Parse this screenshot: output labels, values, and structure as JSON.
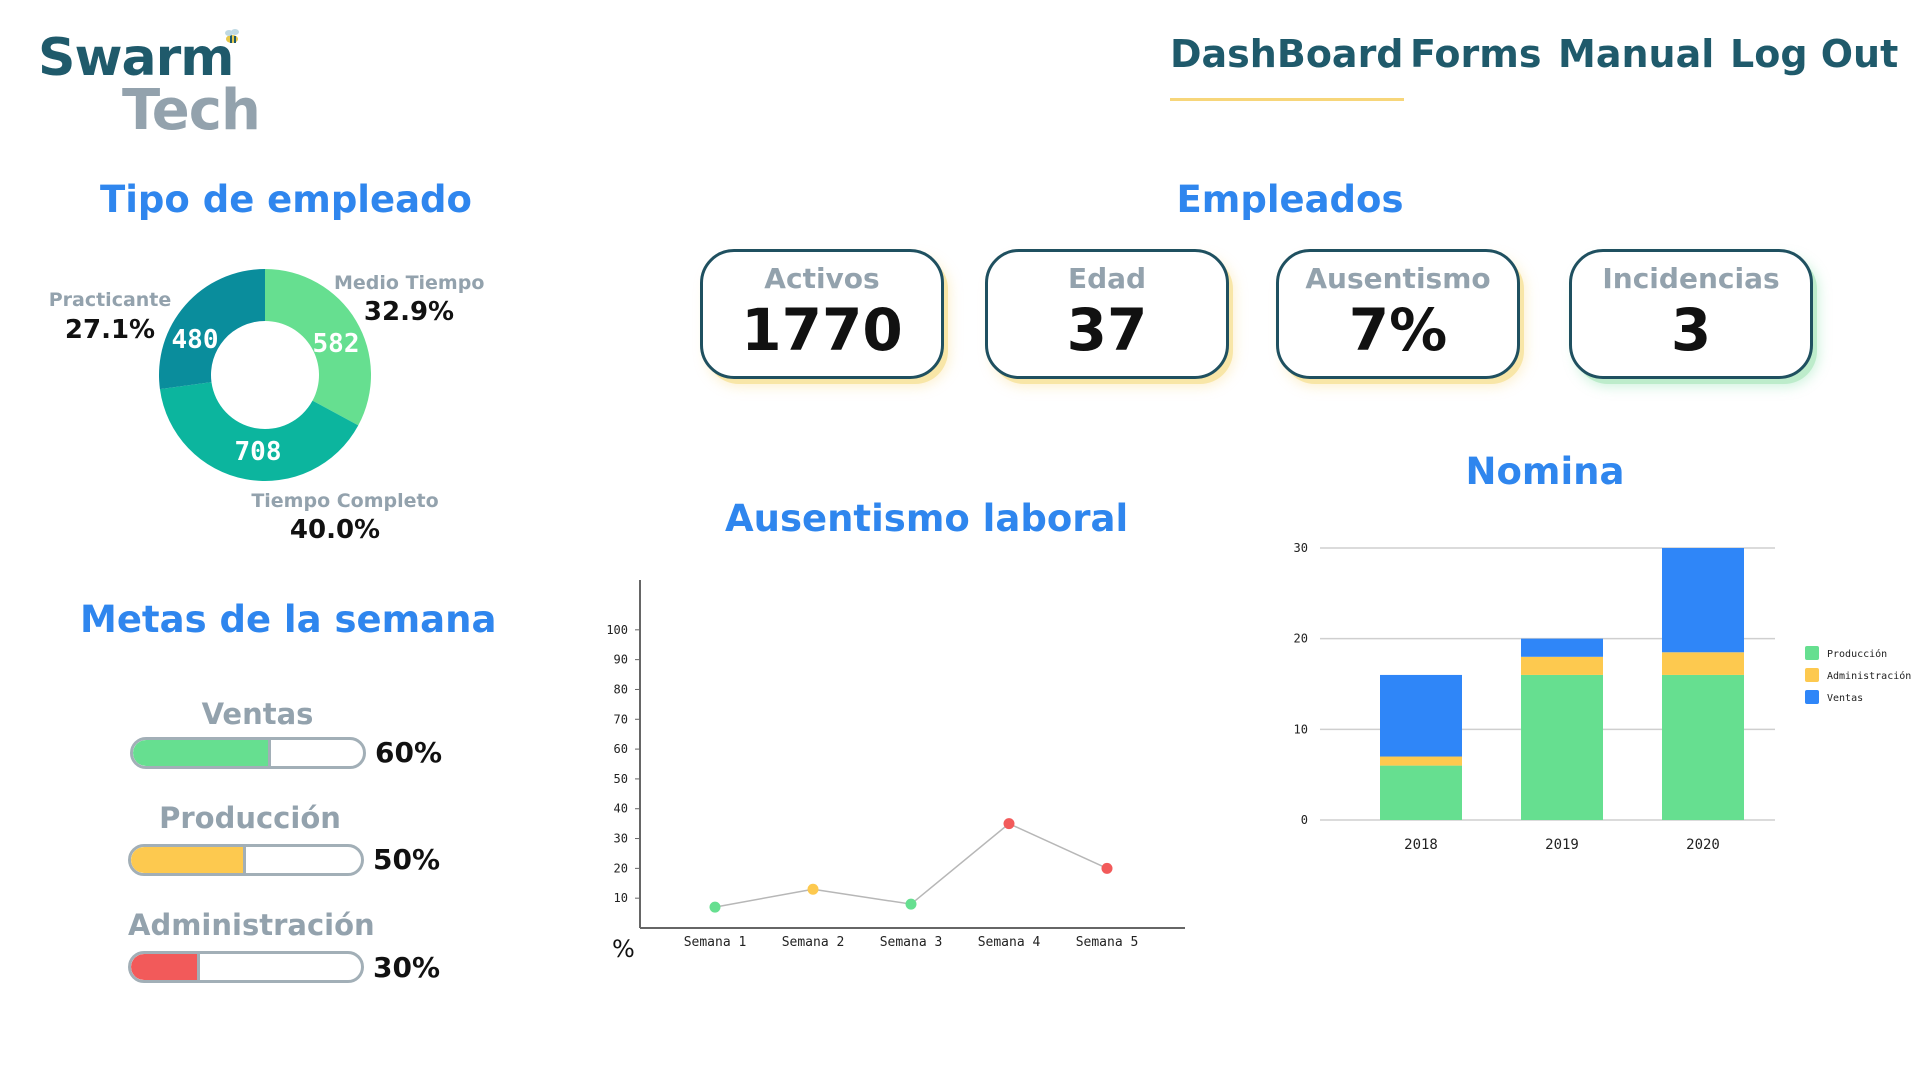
{
  "logo": {
    "line1": "Swarm",
    "line2": "Tech"
  },
  "nav": [
    {
      "label": "DashBoard",
      "active": true
    },
    {
      "label": "Forms",
      "active": false
    },
    {
      "label": "Manual",
      "active": false
    },
    {
      "label": "Log Out",
      "active": false
    }
  ],
  "employee_type": {
    "title": "Tipo de empleado",
    "segments": [
      {
        "name": "Medio Tiempo",
        "count": "582",
        "pct": "32.9%",
        "color": "#66df90"
      },
      {
        "name": "Tiempo Completo",
        "count": "708",
        "pct": "40.0%",
        "color": "#0cb59e"
      },
      {
        "name": "Practicante",
        "count": "480",
        "pct": "27.1%",
        "color": "#0a8d9c"
      }
    ]
  },
  "employees": {
    "title": "Empleados",
    "kpis": [
      {
        "label": "Activos",
        "value": "1770"
      },
      {
        "label": "Edad",
        "value": "37"
      },
      {
        "label": "Ausentismo",
        "value": "7%"
      },
      {
        "label": "Incidencias",
        "value": "3"
      }
    ]
  },
  "goals": {
    "title": "Metas de la semana",
    "items": [
      {
        "label": "Ventas",
        "pct": "60%",
        "value": 0.6,
        "color": "#66df90"
      },
      {
        "label": "Producción",
        "pct": "50%",
        "value": 0.5,
        "color": "#fdc94f"
      },
      {
        "label": "Administración",
        "pct": "30%",
        "value": 0.3,
        "color": "#f25a5a"
      }
    ]
  },
  "absenteeism": {
    "title": "Ausentismo laboral",
    "unit": "%",
    "chart_data": {
      "type": "line",
      "categories": [
        "Semana 1",
        "Semana 2",
        "Semana 3",
        "Semana 4",
        "Semana 5"
      ],
      "values": [
        7,
        13,
        8,
        35,
        20
      ],
      "point_colors": [
        "#66df90",
        "#fdc94f",
        "#66df90",
        "#f25a5a",
        "#f25a5a"
      ],
      "yticks": [
        10,
        20,
        30,
        40,
        50,
        60,
        70,
        80,
        90,
        100
      ],
      "ylim": [
        0,
        110
      ],
      "title": "Ausentismo laboral",
      "ylabel": "%"
    }
  },
  "payroll": {
    "title": "Nomina",
    "chart_data": {
      "type": "bar",
      "stacked": true,
      "categories": [
        "2018",
        "2019",
        "2020"
      ],
      "series": [
        {
          "name": "Producción",
          "values": [
            6,
            16,
            16
          ],
          "color": "#66df90"
        },
        {
          "name": "Administración",
          "values": [
            1,
            2,
            2.5
          ],
          "color": "#fdc94f"
        },
        {
          "name": "Ventas",
          "values": [
            9,
            2,
            11.5
          ],
          "color": "#2f86f8"
        }
      ],
      "yticks": [
        0,
        10,
        20,
        30
      ],
      "ylim": [
        0,
        30
      ],
      "legend": "right",
      "title": "Nomina"
    }
  }
}
